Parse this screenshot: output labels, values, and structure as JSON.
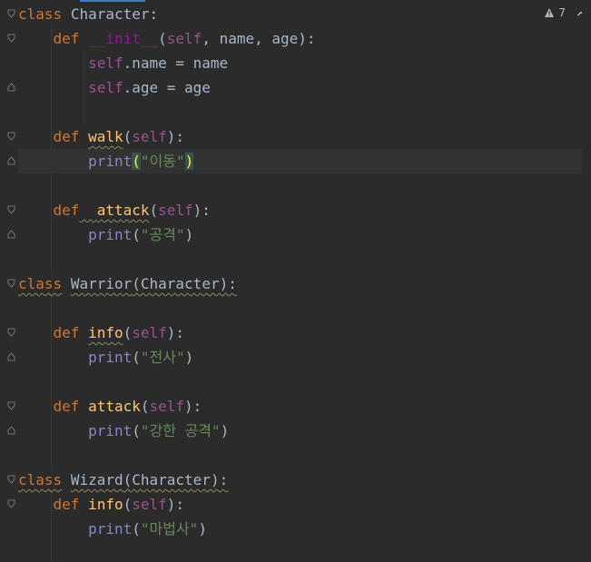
{
  "editor": {
    "inspection_count": "7",
    "lines": [
      {
        "tokens": [
          {
            "t": "class",
            "c": "kw"
          },
          {
            "t": " "
          },
          {
            "t": "Character",
            "c": "plain"
          },
          {
            "t": ":",
            "c": "plain"
          }
        ]
      },
      {
        "tokens": [
          {
            "t": "    "
          },
          {
            "t": "def",
            "c": "kw"
          },
          {
            "t": " "
          },
          {
            "t": "__init__",
            "c": "magic"
          },
          {
            "t": "(",
            "c": "plain"
          },
          {
            "t": "self",
            "c": "self"
          },
          {
            "t": ", name, age):",
            "c": "plain"
          }
        ]
      },
      {
        "tokens": [
          {
            "t": "        "
          },
          {
            "t": "self",
            "c": "self"
          },
          {
            "t": ".name = name",
            "c": "plain"
          }
        ]
      },
      {
        "tokens": [
          {
            "t": "        "
          },
          {
            "t": "self",
            "c": "self"
          },
          {
            "t": ".age = age",
            "c": "plain"
          }
        ]
      },
      {
        "tokens": []
      },
      {
        "tokens": [
          {
            "t": "    "
          },
          {
            "t": "def",
            "c": "kw"
          },
          {
            "t": " "
          },
          {
            "t": "walk",
            "c": "fn"
          },
          {
            "t": "(",
            "c": "plain"
          },
          {
            "t": "self",
            "c": "self"
          },
          {
            "t": "):",
            "c": "plain"
          }
        ]
      },
      {
        "tokens": [
          {
            "t": "        "
          },
          {
            "t": "print",
            "c": "builtin"
          },
          {
            "t": "(",
            "c": "brace"
          },
          {
            "t": "\"이동\"",
            "c": "str"
          },
          {
            "t": ")",
            "c": "brace"
          }
        ]
      },
      {
        "tokens": []
      },
      {
        "tokens": [
          {
            "t": "    "
          },
          {
            "t": "def",
            "c": "kw"
          },
          {
            "t": "  "
          },
          {
            "t": "attack",
            "c": "fn"
          },
          {
            "t": "(",
            "c": "plain"
          },
          {
            "t": "self",
            "c": "self"
          },
          {
            "t": "):",
            "c": "plain"
          }
        ]
      },
      {
        "tokens": [
          {
            "t": "        "
          },
          {
            "t": "print",
            "c": "builtin"
          },
          {
            "t": "(",
            "c": "plain"
          },
          {
            "t": "\"공격\"",
            "c": "str"
          },
          {
            "t": ")",
            "c": "plain"
          }
        ]
      },
      {
        "tokens": []
      },
      {
        "tokens": [
          {
            "t": "class",
            "c": "kw"
          },
          {
            "t": " "
          },
          {
            "t": "Warrior",
            "c": "plain"
          },
          {
            "t": "(Character):",
            "c": "plain"
          }
        ]
      },
      {
        "tokens": []
      },
      {
        "tokens": [
          {
            "t": "    "
          },
          {
            "t": "def",
            "c": "kw"
          },
          {
            "t": " "
          },
          {
            "t": "info",
            "c": "fn"
          },
          {
            "t": "(",
            "c": "plain"
          },
          {
            "t": "self",
            "c": "self"
          },
          {
            "t": "):",
            "c": "plain"
          }
        ]
      },
      {
        "tokens": [
          {
            "t": "        "
          },
          {
            "t": "print",
            "c": "builtin"
          },
          {
            "t": "(",
            "c": "plain"
          },
          {
            "t": "\"전사\"",
            "c": "str"
          },
          {
            "t": ")",
            "c": "plain"
          }
        ]
      },
      {
        "tokens": []
      },
      {
        "tokens": [
          {
            "t": "    "
          },
          {
            "t": "def",
            "c": "kw"
          },
          {
            "t": " "
          },
          {
            "t": "attack",
            "c": "fn"
          },
          {
            "t": "(",
            "c": "plain"
          },
          {
            "t": "self",
            "c": "self"
          },
          {
            "t": "):",
            "c": "plain"
          }
        ]
      },
      {
        "tokens": [
          {
            "t": "        "
          },
          {
            "t": "print",
            "c": "builtin"
          },
          {
            "t": "(",
            "c": "plain"
          },
          {
            "t": "\"강한 공격\"",
            "c": "str"
          },
          {
            "t": ")",
            "c": "plain"
          }
        ]
      },
      {
        "tokens": []
      },
      {
        "tokens": [
          {
            "t": "class",
            "c": "kw"
          },
          {
            "t": " "
          },
          {
            "t": "Wizard",
            "c": "plain"
          },
          {
            "t": "(Character):",
            "c": "plain"
          }
        ]
      },
      {
        "tokens": [
          {
            "t": "    "
          },
          {
            "t": "def",
            "c": "kw"
          },
          {
            "t": " "
          },
          {
            "t": "info",
            "c": "fn"
          },
          {
            "t": "(",
            "c": "plain"
          },
          {
            "t": "self",
            "c": "self"
          },
          {
            "t": "):",
            "c": "plain"
          }
        ]
      },
      {
        "tokens": [
          {
            "t": "        "
          },
          {
            "t": "print",
            "c": "builtin"
          },
          {
            "t": "(",
            "c": "plain"
          },
          {
            "t": "\"마법사\"",
            "c": "str"
          },
          {
            "t": ")",
            "c": "plain"
          }
        ]
      },
      {
        "tokens": []
      }
    ]
  }
}
